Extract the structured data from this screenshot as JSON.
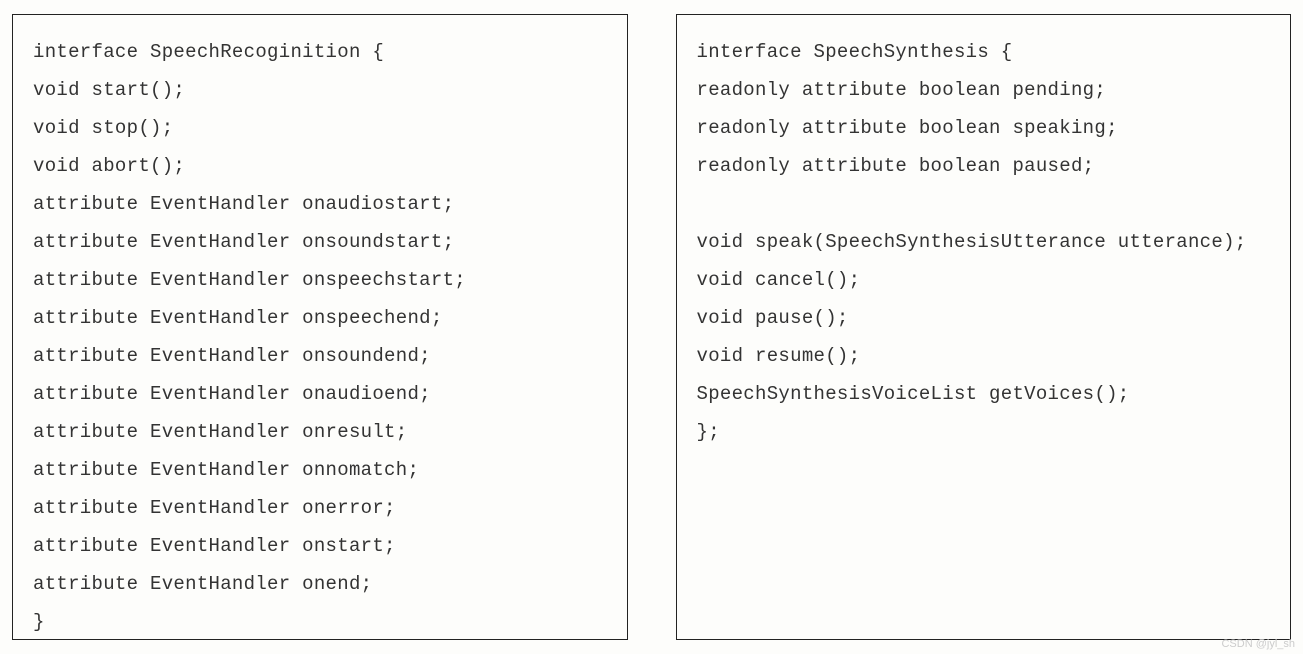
{
  "left": {
    "lines": [
      "interface SpeechRecoginition {",
      "void start();",
      "void stop();",
      "void abort();",
      "attribute EventHandler onaudiostart;",
      "attribute EventHandler onsoundstart;",
      "attribute EventHandler onspeechstart;",
      "attribute EventHandler onspeechend;",
      "attribute EventHandler onsoundend;",
      "attribute EventHandler onaudioend;",
      "attribute EventHandler onresult;",
      "attribute EventHandler onnomatch;",
      "attribute EventHandler onerror;",
      "attribute EventHandler onstart;",
      "attribute EventHandler onend;",
      "}"
    ]
  },
  "right": {
    "lines": [
      "interface SpeechSynthesis {",
      "readonly attribute boolean pending;",
      "readonly attribute boolean speaking;",
      "readonly attribute boolean paused;",
      "",
      "void speak(SpeechSynthesisUtterance utterance);",
      "void cancel();",
      "void pause();",
      "void resume();",
      "SpeechSynthesisVoiceList getVoices();",
      "};"
    ]
  },
  "watermark": "CSDN @jyl_sh"
}
